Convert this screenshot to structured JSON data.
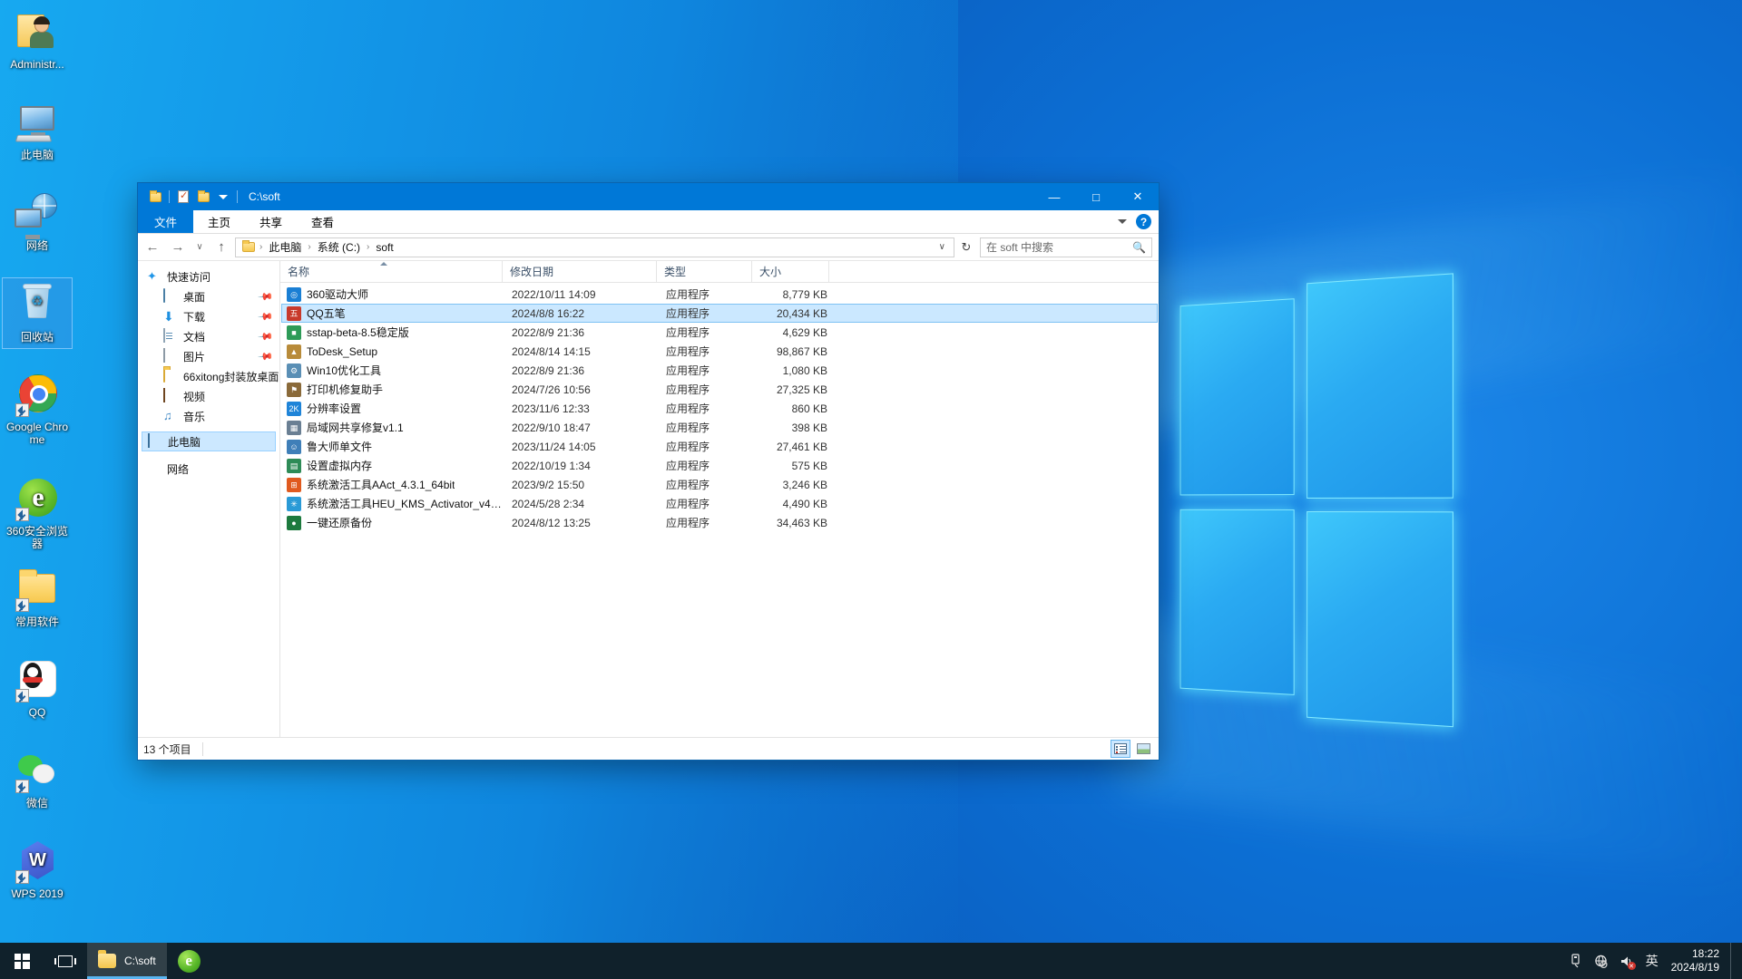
{
  "desktop": {
    "icons": [
      {
        "label": "Administr...",
        "icon": "user-folder-icon",
        "selected": false,
        "shortcut": false
      },
      {
        "label": "此电脑",
        "icon": "this-pc-icon",
        "selected": false,
        "shortcut": false
      },
      {
        "label": "网络",
        "icon": "network-icon",
        "selected": false,
        "shortcut": false
      },
      {
        "label": "回收站",
        "icon": "recycle-bin-icon",
        "selected": true,
        "shortcut": false
      },
      {
        "label": "Google Chrome",
        "icon": "chrome-icon",
        "selected": false,
        "shortcut": true
      },
      {
        "label": "360安全浏览器",
        "icon": "360-browser-icon",
        "selected": false,
        "shortcut": true
      },
      {
        "label": "常用软件",
        "icon": "folder-icon",
        "selected": false,
        "shortcut": true
      },
      {
        "label": "QQ",
        "icon": "qq-icon",
        "selected": false,
        "shortcut": true
      },
      {
        "label": "微信",
        "icon": "wechat-icon",
        "selected": false,
        "shortcut": true
      },
      {
        "label": "WPS 2019",
        "icon": "wps-icon",
        "selected": false,
        "shortcut": true
      }
    ]
  },
  "explorer": {
    "title": "C:\\soft",
    "quick_access_toolbar": [
      {
        "name": "folder-icon"
      },
      {
        "name": "properties-icon"
      },
      {
        "name": "new-folder-icon"
      },
      {
        "name": "customize-dropdown-icon"
      }
    ],
    "window_controls": {
      "minimize": "—",
      "maximize": "□",
      "close": "✕"
    },
    "ribbon": {
      "tabs": [
        {
          "label": "文件",
          "active": true
        },
        {
          "label": "主页",
          "active": false
        },
        {
          "label": "共享",
          "active": false
        },
        {
          "label": "查看",
          "active": false
        }
      ],
      "expand_label": "∨",
      "help_label": "?"
    },
    "navigation": {
      "back": "←",
      "forward": "→",
      "recent": "∨",
      "up": "↑",
      "breadcrumbs": [
        "此电脑",
        "系统 (C:)",
        "soft"
      ],
      "breadcrumb_separator": "›",
      "dropdown": "∨",
      "refresh": "↻"
    },
    "search": {
      "placeholder": "在 soft 中搜索",
      "icon": "search-icon"
    },
    "nav_pane": [
      {
        "label": "快速访问",
        "icon": "quick-access-star-icon",
        "level": "root",
        "pinned": false,
        "selected": false
      },
      {
        "label": "桌面",
        "icon": "desktop-icon",
        "level": "child",
        "pinned": true,
        "selected": false
      },
      {
        "label": "下载",
        "icon": "downloads-icon",
        "level": "child",
        "pinned": true,
        "selected": false
      },
      {
        "label": "文档",
        "icon": "documents-icon",
        "level": "child",
        "pinned": true,
        "selected": false
      },
      {
        "label": "图片",
        "icon": "pictures-icon",
        "level": "child",
        "pinned": true,
        "selected": false
      },
      {
        "label": "66xitong封装放桌面",
        "icon": "folder-icon",
        "level": "child",
        "pinned": false,
        "selected": false
      },
      {
        "label": "视频",
        "icon": "videos-icon",
        "level": "child",
        "pinned": false,
        "selected": false
      },
      {
        "label": "音乐",
        "icon": "music-icon",
        "level": "child",
        "pinned": false,
        "selected": false
      },
      {
        "label": "此电脑",
        "icon": "this-pc-icon",
        "level": "root",
        "pinned": false,
        "selected": true
      },
      {
        "label": "网络",
        "icon": "network-icon",
        "level": "root",
        "pinned": false,
        "selected": false
      }
    ],
    "columns": [
      {
        "label": "名称",
        "sorted": true
      },
      {
        "label": "修改日期",
        "sorted": false
      },
      {
        "label": "类型",
        "sorted": false
      },
      {
        "label": "大小",
        "sorted": false
      }
    ],
    "files": [
      {
        "name": "360驱动大师",
        "date": "2022/10/11 14:09",
        "type": "应用程序",
        "size": "8,779 KB",
        "selected": false,
        "icon_color": "#1a7fd4",
        "icon_glyph": "◎"
      },
      {
        "name": "QQ五笔",
        "date": "2024/8/8 16:22",
        "type": "应用程序",
        "size": "20,434 KB",
        "selected": true,
        "icon_color": "#c8392b",
        "icon_glyph": "五"
      },
      {
        "name": "sstap-beta-8.5稳定版",
        "date": "2022/8/9 21:36",
        "type": "应用程序",
        "size": "4,629 KB",
        "selected": false,
        "icon_color": "#2e9b58",
        "icon_glyph": "■"
      },
      {
        "name": "ToDesk_Setup",
        "date": "2024/8/14 14:15",
        "type": "应用程序",
        "size": "98,867 KB",
        "selected": false,
        "icon_color": "#b88b3a",
        "icon_glyph": "▲"
      },
      {
        "name": "Win10优化工具",
        "date": "2022/8/9 21:36",
        "type": "应用程序",
        "size": "1,080 KB",
        "selected": false,
        "icon_color": "#5a8fb5",
        "icon_glyph": "⚙"
      },
      {
        "name": "打印机修复助手",
        "date": "2024/7/26 10:56",
        "type": "应用程序",
        "size": "27,325 KB",
        "selected": false,
        "icon_color": "#8a6a3a",
        "icon_glyph": "⚑"
      },
      {
        "name": "分辨率设置",
        "date": "2023/11/6 12:33",
        "type": "应用程序",
        "size": "860 KB",
        "selected": false,
        "icon_color": "#1f84d8",
        "icon_glyph": "2K"
      },
      {
        "name": "局域网共享修复v1.1",
        "date": "2022/9/10 18:47",
        "type": "应用程序",
        "size": "398 KB",
        "selected": false,
        "icon_color": "#6a7f93",
        "icon_glyph": "▦"
      },
      {
        "name": "鲁大师单文件",
        "date": "2023/11/24 14:05",
        "type": "应用程序",
        "size": "27,461 KB",
        "selected": false,
        "icon_color": "#3f7fb8",
        "icon_glyph": "☺"
      },
      {
        "name": "设置虚拟内存",
        "date": "2022/10/19 1:34",
        "type": "应用程序",
        "size": "575 KB",
        "selected": false,
        "icon_color": "#2e8b57",
        "icon_glyph": "▤"
      },
      {
        "name": "系统激活工具AAct_4.3.1_64bit",
        "date": "2023/9/2 15:50",
        "type": "应用程序",
        "size": "3,246 KB",
        "selected": false,
        "icon_color": "#e05a1f",
        "icon_glyph": "⊞"
      },
      {
        "name": "系统激活工具HEU_KMS_Activator_v42....",
        "date": "2024/5/28 2:34",
        "type": "应用程序",
        "size": "4,490 KB",
        "selected": false,
        "icon_color": "#2a9ad6",
        "icon_glyph": "✳"
      },
      {
        "name": "一键还原备份",
        "date": "2024/8/12 13:25",
        "type": "应用程序",
        "size": "34,463 KB",
        "selected": false,
        "icon_color": "#1d7a3e",
        "icon_glyph": "●"
      }
    ],
    "status": {
      "item_count": "13 个项目",
      "view_details": "details-view-icon",
      "view_large_icons": "large-icons-view-icon"
    }
  },
  "taskbar": {
    "start": "start-button",
    "task_view": "task-view-button",
    "items": [
      {
        "label": "C:\\soft",
        "icon": "folder-icon",
        "active": true
      },
      {
        "label": "",
        "icon": "360-browser-icon",
        "active": false
      }
    ],
    "tray": [
      {
        "name": "usb-eject-icon",
        "glyph": "⌨"
      },
      {
        "name": "network-disconnected-icon",
        "glyph": "⊕"
      },
      {
        "name": "volume-muted-icon",
        "glyph": "🔈"
      },
      {
        "name": "ime-icon",
        "glyph": "英"
      }
    ],
    "clock": {
      "time": "18:22",
      "date": "2024/8/19"
    }
  }
}
